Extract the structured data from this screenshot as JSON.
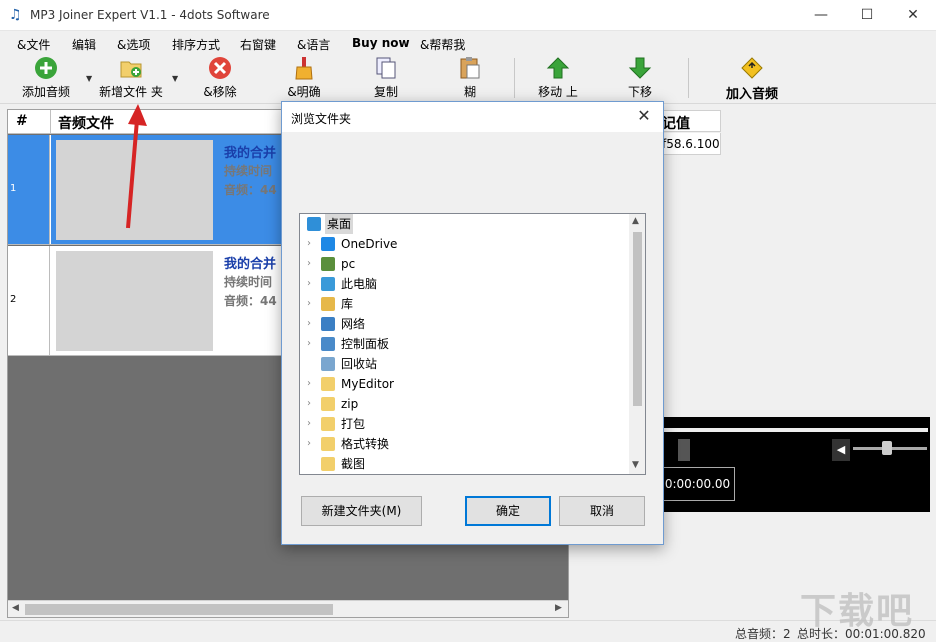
{
  "window": {
    "title": "MP3 Joiner Expert V1.1 - 4dots Software"
  },
  "menu": [
    "&文件",
    "编辑",
    "&选项",
    "排序方式",
    "右窗键",
    "&语言",
    "Buy now",
    "&帮帮我"
  ],
  "toolbar": {
    "add_audio": "添加音频",
    "add_folder": "新增文件 夹",
    "remove": "&移除",
    "clear": "&明确",
    "copy": "复制",
    "paste": "糊",
    "move_up": "移动 上",
    "move_down": "下移",
    "join": "加入音频"
  },
  "grid": {
    "col_num": "#",
    "col_file": "音频文件",
    "rows": [
      {
        "num": "1",
        "title": "我的合并",
        "duration": "持续时间",
        "format": "音频：44"
      },
      {
        "num": "2",
        "title": "我的合并",
        "duration": "持续时间",
        "format": "音频：44"
      }
    ]
  },
  "right_panel": {
    "header": "记值",
    "value": "f58.6.100"
  },
  "player": {
    "time": "0:00:00.00"
  },
  "status": {
    "count": "总音频：2",
    "duration": "总时长：00:01:00.820"
  },
  "watermark": "下载吧",
  "dialog": {
    "title": "浏览文件夹",
    "tree": [
      {
        "label": "桌面",
        "icon": "desktop-icon",
        "color": "#2f8fd8",
        "chevron": false,
        "selected": true,
        "indent": 0
      },
      {
        "label": "OneDrive",
        "icon": "cloud-icon",
        "color": "#1e88e5",
        "chevron": true,
        "selected": false,
        "indent": 1
      },
      {
        "label": "pc",
        "icon": "user-icon",
        "color": "#5a8f3c",
        "chevron": true,
        "selected": false,
        "indent": 1
      },
      {
        "label": "此电脑",
        "icon": "computer-icon",
        "color": "#3a9ad9",
        "chevron": true,
        "selected": false,
        "indent": 1
      },
      {
        "label": "库",
        "icon": "library-icon",
        "color": "#e6b84a",
        "chevron": true,
        "selected": false,
        "indent": 1
      },
      {
        "label": "网络",
        "icon": "network-icon",
        "color": "#3b7fc4",
        "chevron": true,
        "selected": false,
        "indent": 1
      },
      {
        "label": "控制面板",
        "icon": "control-panel-icon",
        "color": "#4a8ac9",
        "chevron": true,
        "selected": false,
        "indent": 1
      },
      {
        "label": "回收站",
        "icon": "recycle-bin-icon",
        "color": "#7aa6cf",
        "chevron": false,
        "selected": false,
        "indent": 1
      },
      {
        "label": "MyEditor",
        "icon": "folder-icon",
        "color": "#f2cf6b",
        "chevron": true,
        "selected": false,
        "indent": 1
      },
      {
        "label": "zip",
        "icon": "folder-icon",
        "color": "#f2cf6b",
        "chevron": true,
        "selected": false,
        "indent": 1
      },
      {
        "label": "打包",
        "icon": "folder-icon",
        "color": "#f2cf6b",
        "chevron": true,
        "selected": false,
        "indent": 1
      },
      {
        "label": "格式转换",
        "icon": "folder-icon",
        "color": "#f2cf6b",
        "chevron": true,
        "selected": false,
        "indent": 1
      },
      {
        "label": "截图",
        "icon": "folder-icon",
        "color": "#f2cf6b",
        "chevron": false,
        "selected": false,
        "indent": 1
      }
    ],
    "new_folder": "新建文件夹(M)",
    "ok": "确定",
    "cancel": "取消"
  }
}
